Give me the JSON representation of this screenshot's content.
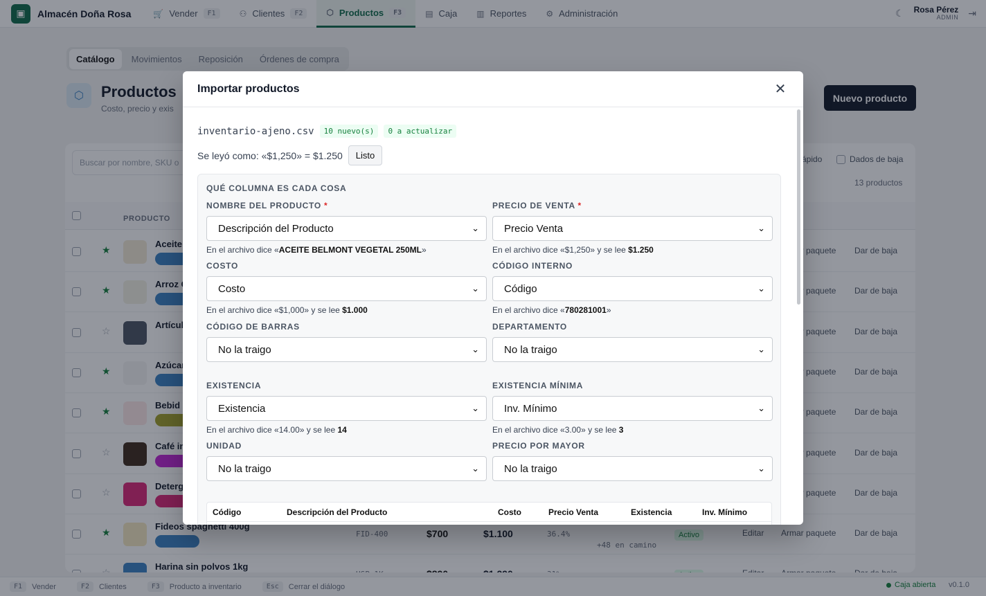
{
  "app": {
    "store_name": "Almacén Doña Rosa"
  },
  "nav": [
    {
      "label": "Vender",
      "key": "F1",
      "icon": "cart-icon",
      "active": false
    },
    {
      "label": "Clientes",
      "key": "F2",
      "icon": "users-icon",
      "active": false
    },
    {
      "label": "Productos",
      "key": "F3",
      "icon": "box-icon",
      "active": true
    },
    {
      "label": "Caja",
      "key": "",
      "icon": "cash-icon",
      "active": false
    },
    {
      "label": "Reportes",
      "key": "",
      "icon": "chart-icon",
      "active": false
    },
    {
      "label": "Administración",
      "key": "",
      "icon": "gear-icon",
      "active": false
    }
  ],
  "user": {
    "name": "Rosa Pérez",
    "role": "ADMIN"
  },
  "subtabs": [
    "Catálogo",
    "Movimientos",
    "Reposición",
    "Órdenes de compra"
  ],
  "page": {
    "title": "Productos",
    "subtitle": "Costo, precio y exis",
    "new_button": "Nuevo producto"
  },
  "background_list": {
    "search_placeholder": "Buscar por nombre, SKU o",
    "filter_fast": "rápido",
    "filter_inactive": "Dados de baja",
    "count": "13 productos",
    "column_product": "PRODUCTO",
    "rows": [
      {
        "name": "Aceite",
        "starred": true
      },
      {
        "name": "Arroz G",
        "starred": true
      },
      {
        "name": "Artícul",
        "starred": false
      },
      {
        "name": "Azúcar",
        "starred": true
      },
      {
        "name": "Bebid",
        "starred": true
      },
      {
        "name": "Café in",
        "starred": false
      },
      {
        "name": "Deterg",
        "starred": false
      },
      {
        "name": "Fideos spaghetti 400g",
        "starred": true,
        "sku": "FID-400",
        "cost": "$700",
        "price": "$1.100",
        "margin": "36.4%",
        "incoming": "+48 en camino"
      },
      {
        "name": "Harina sin polvos 1kg",
        "starred": false,
        "sku": "HSP-1K",
        "cost": "$890",
        "price": "$1.290",
        "margin": "31%"
      }
    ],
    "row_actions": {
      "edit": "Editar",
      "pack": "Armar paquete",
      "deactivate": "Dar de baja",
      "status": "Activo"
    }
  },
  "footer": {
    "shortcuts": [
      {
        "key": "F1",
        "label": "Vender"
      },
      {
        "key": "F2",
        "label": "Clientes"
      },
      {
        "key": "F3",
        "label": "Producto a inventario"
      },
      {
        "key": "Esc",
        "label": "Cerrar el diálogo"
      }
    ],
    "status": "Caja abierta",
    "version": "v0.1.0"
  },
  "modal": {
    "title": "Importar productos",
    "file_name": "inventario-ajeno.csv",
    "new_count_tag": "10 nuevo(s)",
    "update_tag": "0 a actualizar",
    "read_as": "Se leyó como: «$1,250» = $1.250",
    "ok_button": "Listo",
    "mapping_title": "QUÉ COLUMNA ES CADA COSA",
    "fields": [
      {
        "label": "NOMBRE DEL PRODUCTO",
        "required": true,
        "value": "Descripción del Producto",
        "hint_pre": "En el archivo dice «",
        "hint_bold": "ACEITE BELMONT VEGETAL 250ML",
        "hint_post": "»"
      },
      {
        "label": "PRECIO DE VENTA",
        "required": true,
        "value": "Precio Venta",
        "hint_pre": "En el archivo dice «$1,250» y se lee ",
        "hint_bold": "$1.250",
        "hint_post": ""
      },
      {
        "label": "COSTO",
        "required": false,
        "value": "Costo",
        "hint_pre": "En el archivo dice «$1,000» y se lee ",
        "hint_bold": "$1.000",
        "hint_post": ""
      },
      {
        "label": "CÓDIGO INTERNO",
        "required": false,
        "value": "Código",
        "hint_pre": "En el archivo dice «",
        "hint_bold": "780281001",
        "hint_post": "»"
      },
      {
        "label": "CÓDIGO DE BARRAS",
        "required": false,
        "value": "No la traigo",
        "hint_pre": "",
        "hint_bold": "",
        "hint_post": ""
      },
      {
        "label": "DEPARTAMENTO",
        "required": false,
        "value": "No la traigo",
        "hint_pre": "",
        "hint_bold": "",
        "hint_post": ""
      },
      {
        "label": "EXISTENCIA",
        "required": false,
        "value": "Existencia",
        "hint_pre": "En el archivo dice «14.00» y se lee ",
        "hint_bold": "14",
        "hint_post": ""
      },
      {
        "label": "EXISTENCIA MÍNIMA",
        "required": false,
        "value": "Inv. Mínimo",
        "hint_pre": "En el archivo dice «3.00» y se lee ",
        "hint_bold": "3",
        "hint_post": ""
      },
      {
        "label": "UNIDAD",
        "required": false,
        "value": "No la traigo",
        "hint_pre": "",
        "hint_bold": "",
        "hint_post": ""
      },
      {
        "label": "PRECIO POR MAYOR",
        "required": false,
        "value": "No la traigo",
        "hint_pre": "",
        "hint_bold": "",
        "hint_post": ""
      }
    ],
    "preview_columns": [
      "Código",
      "Descripción del Producto",
      "Costo",
      "Precio Venta",
      "Existencia",
      "Inv. Mínimo"
    ]
  }
}
